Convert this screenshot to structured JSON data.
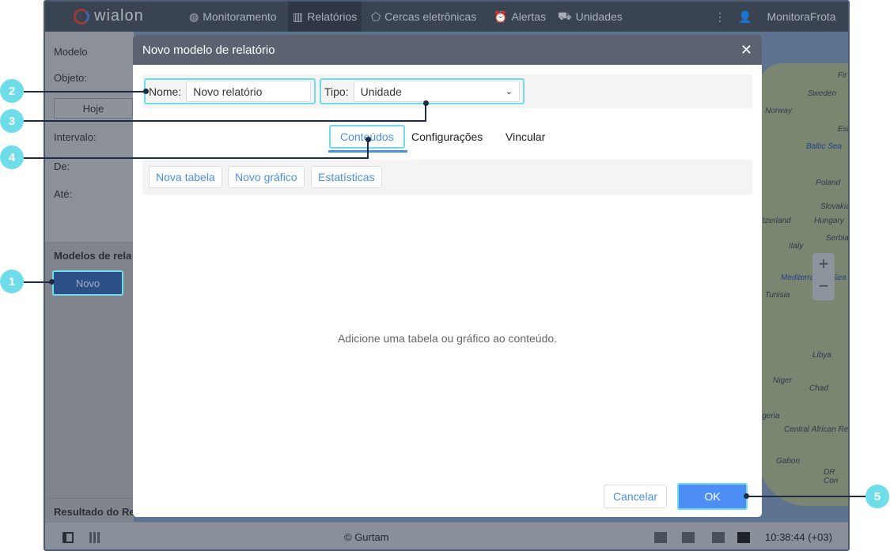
{
  "topbar": {
    "logo": "wialon",
    "nav": [
      {
        "label": "Monitoramento",
        "icon": "globe-icon"
      },
      {
        "label": "Relatórios",
        "icon": "report-icon"
      },
      {
        "label": "Cercas eletrônicas",
        "icon": "geofence-icon"
      },
      {
        "label": "Alertas",
        "icon": "alarm-icon"
      },
      {
        "label": "Unidades",
        "icon": "bus-icon"
      }
    ],
    "user": "MonitoraFrota"
  },
  "left": {
    "modelo": "Modelo",
    "objeto": "Objeto:",
    "hoje": "Hoje",
    "intervalo": "Intervalo:",
    "de": "De:",
    "ate": "Até:",
    "modelos": "Modelos de rela",
    "novo": "Novo",
    "resultado": "Resultado do Re"
  },
  "map": {
    "labels": [
      "Fir",
      "Sweden",
      "Norway",
      "Est",
      "Baltic Sea",
      "Poland",
      "Slovakia",
      "tzerland",
      "Hungary",
      "Serbia",
      "Italy",
      "Mediterra",
      "Sea",
      "Tunisia",
      "Libya",
      "Niger",
      "Chad",
      "igeria",
      "Central African Re",
      "Gabon",
      "DR Con"
    ],
    "zoom_in": "+",
    "zoom_out": "−"
  },
  "dialog": {
    "title": "Novo modelo de relatório",
    "name_label": "Nome:",
    "name_value": "Novo relatório",
    "type_label": "Tipo:",
    "type_value": "Unidade",
    "tabs": [
      "Conteúdos",
      "Configurações",
      "Vincular"
    ],
    "buttons": [
      "Nova tabela",
      "Novo gráfico",
      "Estatísticas"
    ],
    "empty": "Adicione uma tabela ou gráfico ao conteúdo.",
    "cancel": "Cancelar",
    "ok": "OK"
  },
  "bottombar": {
    "copyright": "© Gurtam",
    "time": "10:38:44 (+03)"
  },
  "callouts": [
    "1",
    "2",
    "3",
    "4",
    "5"
  ],
  "colors": {
    "accent": "#4a90e2",
    "highlight": "#6fdcea",
    "ok": "#4d8ff7"
  }
}
